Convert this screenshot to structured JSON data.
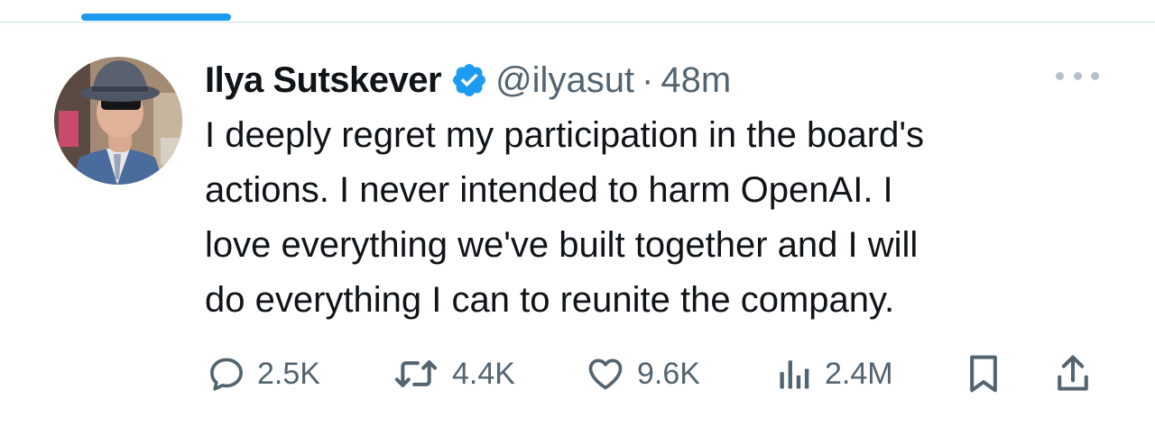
{
  "author": {
    "display_name": "Ilya Sutskever",
    "handle": "@ilyasut",
    "verified": true,
    "avatar_icon": "profile-photo"
  },
  "meta": {
    "separator": "·",
    "time": "48m"
  },
  "tweet": {
    "text_lines": [
      "I deeply regret my participation in the board's",
      "actions. I never intended to harm OpenAI. I",
      "love everything we've built together and I will",
      "do everything I can to reunite the company."
    ]
  },
  "actions": {
    "replies": {
      "count": "2.5K",
      "icon": "reply-icon"
    },
    "reposts": {
      "count": "4.4K",
      "icon": "repost-icon"
    },
    "likes": {
      "count": "9.6K",
      "icon": "like-icon"
    },
    "views": {
      "count": "2.4M",
      "icon": "views-icon"
    },
    "bookmark": {
      "icon": "bookmark-icon"
    },
    "share": {
      "icon": "share-icon"
    }
  },
  "colors": {
    "accent": "#1d9bf0",
    "text_primary": "#0f1419",
    "text_secondary": "#536471"
  }
}
